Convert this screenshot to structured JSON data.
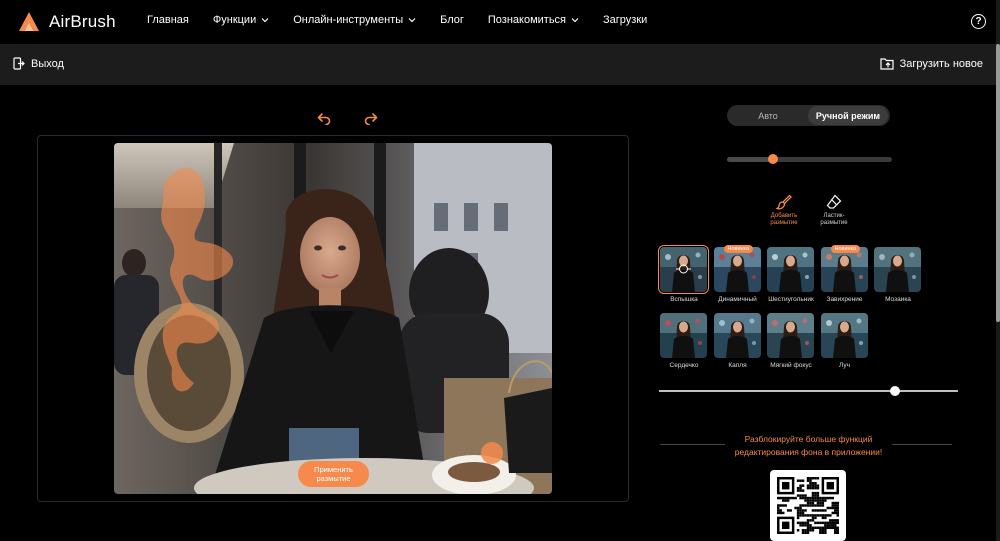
{
  "app": {
    "name": "AirBrush",
    "accent": "#f58a4c"
  },
  "nav": {
    "items": [
      {
        "label": "Главная",
        "has_dropdown": false
      },
      {
        "label": "Функции",
        "has_dropdown": true
      },
      {
        "label": "Онлайн-инструменты",
        "has_dropdown": true
      },
      {
        "label": "Блог",
        "has_dropdown": false
      },
      {
        "label": "Познакомиться",
        "has_dropdown": true
      },
      {
        "label": "Загрузки",
        "has_dropdown": false
      }
    ],
    "help_icon": "question-circle-icon"
  },
  "toolbar": {
    "exit_label": "Выход",
    "upload_label": "Загрузить новое"
  },
  "editor": {
    "apply_label": "Применить размытие"
  },
  "panel": {
    "mode_auto": "Авто",
    "mode_manual": "Ручной режим",
    "mode_selected": "Ручной режим",
    "brush_size_fraction": 0.28,
    "tools": [
      {
        "label": "Добавить размытие",
        "icon": "brush-icon",
        "active": true
      },
      {
        "label": "Ластик-размытие",
        "icon": "eraser-icon",
        "active": false
      }
    ],
    "effects": [
      {
        "label": "Вспышка",
        "badge": "",
        "active": true
      },
      {
        "label": "Динамичный",
        "badge": "Новинка",
        "active": false
      },
      {
        "label": "Шестиугольник",
        "badge": "",
        "active": false
      },
      {
        "label": "Завихрение",
        "badge": "Новинка",
        "active": false
      },
      {
        "label": "Мозаика",
        "badge": "",
        "active": false
      },
      {
        "label": "Сердечко",
        "badge": "",
        "active": false
      },
      {
        "label": "Капля",
        "badge": "",
        "active": false
      },
      {
        "label": "Мягкий фокус",
        "badge": "",
        "active": false
      },
      {
        "label": "Луч",
        "badge": "",
        "active": false
      }
    ],
    "intensity_fraction": 0.79,
    "promo_text": "Разблокируйте больше функций редактирования фона в приложении!"
  }
}
